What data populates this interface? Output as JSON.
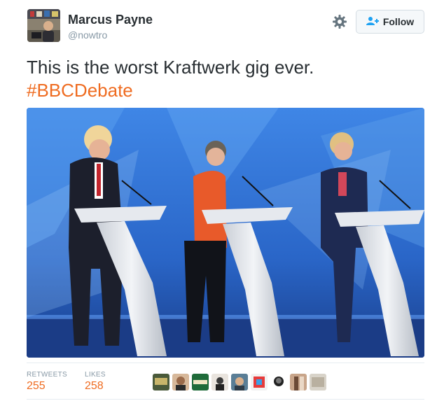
{
  "tweet": {
    "author_name": "Marcus Payne",
    "author_handle": "@nowtro",
    "text": "This is the worst Kraftwerk gig ever.",
    "hashtag": "#BBCDebate",
    "follow_label": "Follow",
    "retweets_label": "RETWEETS",
    "retweets_count": "255",
    "likes_label": "LIKES",
    "likes_count": "258"
  },
  "colors": {
    "accent": "#ef6c21",
    "muted": "#8899a6",
    "text": "#292f33"
  },
  "icons": [
    "gear-icon",
    "follow-person-icon"
  ]
}
